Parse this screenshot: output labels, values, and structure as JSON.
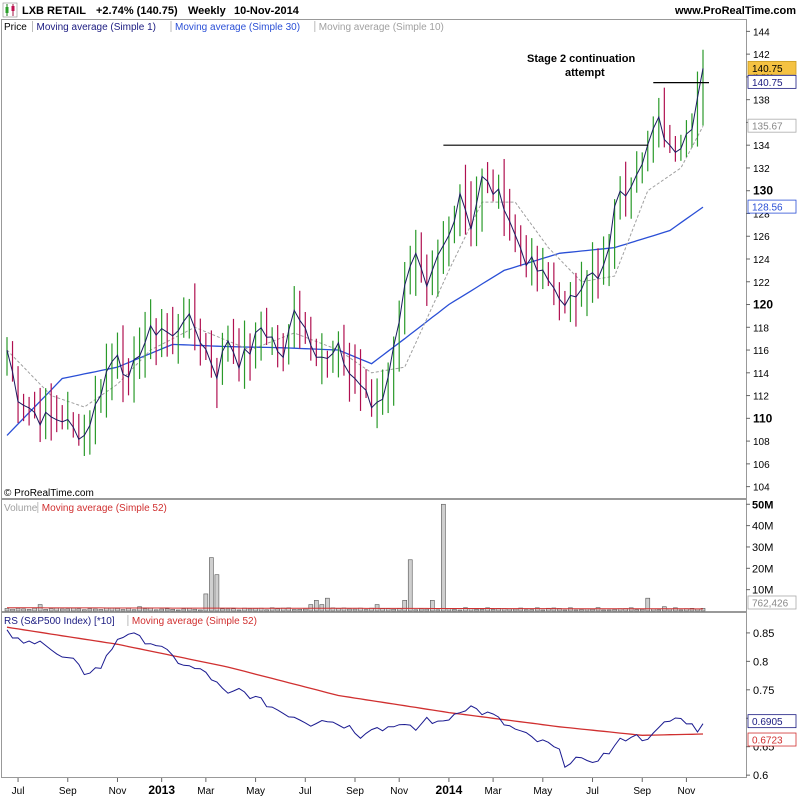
{
  "header": {
    "logo_icon": "candlestick-logo-icon",
    "title": "LXB RETAIL",
    "change": "+2.74% (140.75)",
    "period": "Weekly",
    "date": "10-Nov-2014",
    "website": "www.ProRealTime.com"
  },
  "price_panel": {
    "legend": [
      {
        "text": "Price",
        "color": "#000000"
      },
      {
        "text": "Moving average (Simple 1)",
        "color": "#1a1a80"
      },
      {
        "text": "Moving average (Simple 30)",
        "color": "#2a4fd6"
      },
      {
        "text": "Moving average (Simple 10)",
        "color": "#a0a0a0"
      }
    ],
    "copyright": "© ProRealTime.com",
    "annotation_line1": "Stage 2 continuation",
    "annotation_line2": "attempt",
    "ylim": [
      103,
      145
    ],
    "ticks": [
      "144",
      "142",
      "140",
      "138",
      "136",
      "134",
      "132",
      "130",
      "128",
      "126",
      "124",
      "122",
      "120",
      "118",
      "116",
      "114",
      "112",
      "110",
      "108",
      "106",
      "104"
    ],
    "bold_ticks": [
      "140",
      "130",
      "120",
      "110"
    ],
    "markers": [
      {
        "label": "140.75",
        "value": 140.75,
        "bg": "#f5c242",
        "fg": "#000000",
        "border": "#c89a20"
      },
      {
        "label": "140.75",
        "value": 139.55,
        "bg": "#ffffff",
        "fg": "#1a1a80",
        "border": "#1a1a80"
      },
      {
        "label": "135.67",
        "value": 135.67,
        "bg": "#ffffff",
        "fg": "#888888",
        "border": "#aaaaaa"
      },
      {
        "label": "128.56",
        "value": 128.56,
        "bg": "#ffffff",
        "fg": "#2a4fd6",
        "border": "#2a4fd6"
      }
    ]
  },
  "volume_panel": {
    "legend": [
      {
        "text": "Volume",
        "color": "#a0a0a0"
      },
      {
        "text": "Moving average (Simple 52)",
        "color": "#d03030"
      }
    ],
    "ticks": [
      "50M",
      "40M",
      "30M",
      "20M",
      "10M"
    ],
    "ylim": [
      0,
      52
    ],
    "marker": {
      "label": "762,426",
      "bg": "#ffffff",
      "fg": "#888888",
      "border": "#aaaaaa"
    }
  },
  "rs_panel": {
    "legend": [
      {
        "text": "RS (S&P500 Index) [*10]",
        "color": "#1a1a80"
      },
      {
        "text": "Moving average (Simple 52)",
        "color": "#d03030"
      }
    ],
    "ticks": [
      "0.85",
      "0.8",
      "0.75",
      "0.7",
      "0.65",
      "0.6"
    ],
    "ylim": [
      0.595,
      0.885
    ],
    "markers": [
      {
        "label": "0.6905",
        "value": 0.6905,
        "bg": "#ffffff",
        "fg": "#1a1a80",
        "border": "#1a1a80"
      },
      {
        "label": "0.6723",
        "value": 0.6723,
        "bg": "#ffffff",
        "fg": "#d03030",
        "border": "#d03030"
      }
    ]
  },
  "x_axis": {
    "labels": [
      "Jul",
      "Sep",
      "Nov",
      "2013",
      "Mar",
      "May",
      "Jul",
      "Sep",
      "Nov",
      "2014",
      "Mar",
      "May",
      "Jul",
      "Sep",
      "Nov"
    ],
    "bold_labels": [
      "2013",
      "2014"
    ],
    "week_index": [
      2,
      11,
      20,
      28,
      36,
      45,
      54,
      63,
      71,
      80,
      88,
      97,
      106,
      115,
      123
    ]
  },
  "chart_data": {
    "type": "line",
    "title": "LXB RETAIL",
    "period": "Weekly",
    "x_start": "Jun 2012",
    "x_end": "10-Nov-2014",
    "weeks": 127,
    "price_close_anchors": [
      [
        0,
        116
      ],
      [
        2,
        112
      ],
      [
        6,
        110
      ],
      [
        10,
        110
      ],
      [
        12,
        109
      ],
      [
        14,
        108.5
      ],
      [
        16,
        111
      ],
      [
        18,
        114
      ],
      [
        20,
        116
      ],
      [
        22,
        113
      ],
      [
        24,
        116
      ],
      [
        26,
        117.5
      ],
      [
        28,
        118
      ],
      [
        30,
        117
      ],
      [
        32,
        119
      ],
      [
        34,
        118
      ],
      [
        36,
        116
      ],
      [
        38,
        114
      ],
      [
        40,
        117
      ],
      [
        42,
        115
      ],
      [
        44,
        116
      ],
      [
        46,
        118
      ],
      [
        48,
        117
      ],
      [
        50,
        115
      ],
      [
        52,
        120
      ],
      [
        54,
        118
      ],
      [
        56,
        116
      ],
      [
        58,
        115
      ],
      [
        60,
        116
      ],
      [
        62,
        114
      ],
      [
        64,
        113
      ],
      [
        66,
        111
      ],
      [
        68,
        112
      ],
      [
        70,
        116
      ],
      [
        72,
        122
      ],
      [
        74,
        124
      ],
      [
        76,
        121
      ],
      [
        78,
        124
      ],
      [
        80,
        126
      ],
      [
        82,
        130
      ],
      [
        84,
        127
      ],
      [
        86,
        131
      ],
      [
        88,
        130
      ],
      [
        90,
        129
      ],
      [
        92,
        126
      ],
      [
        94,
        124
      ],
      [
        96,
        123
      ],
      [
        98,
        122
      ],
      [
        100,
        121
      ],
      [
        101,
        119.5
      ],
      [
        103,
        121
      ],
      [
        105,
        123
      ],
      [
        107,
        122
      ],
      [
        109,
        124.5
      ],
      [
        110,
        129
      ],
      [
        112,
        130
      ],
      [
        114,
        132
      ],
      [
        116,
        134
      ],
      [
        118,
        136
      ],
      [
        120,
        134
      ],
      [
        122,
        134
      ],
      [
        124,
        136
      ],
      [
        126,
        140.75
      ]
    ],
    "sma30_anchors": [
      [
        0,
        108.5
      ],
      [
        10,
        113.5
      ],
      [
        20,
        114.5
      ],
      [
        30,
        116.5
      ],
      [
        40,
        116.3
      ],
      [
        50,
        116.2
      ],
      [
        60,
        116
      ],
      [
        66,
        114.8
      ],
      [
        72,
        117
      ],
      [
        80,
        120
      ],
      [
        90,
        123
      ],
      [
        100,
        124.5
      ],
      [
        110,
        125
      ],
      [
        120,
        126.5
      ],
      [
        126,
        128.56
      ]
    ],
    "sma10_anchors": [
      [
        0,
        116
      ],
      [
        8,
        112
      ],
      [
        14,
        111
      ],
      [
        20,
        113
      ],
      [
        26,
        116
      ],
      [
        34,
        118
      ],
      [
        44,
        116
      ],
      [
        52,
        117.5
      ],
      [
        60,
        116
      ],
      [
        66,
        114
      ],
      [
        72,
        114.5
      ],
      [
        80,
        123
      ],
      [
        86,
        129
      ],
      [
        92,
        129
      ],
      [
        98,
        125
      ],
      [
        104,
        122
      ],
      [
        110,
        122.5
      ],
      [
        116,
        130
      ],
      [
        122,
        132
      ],
      [
        126,
        135.67
      ]
    ],
    "breakout_line_1": {
      "x": [
        79,
        115
      ],
      "y": [
        134,
        134
      ]
    },
    "breakout_line_2": {
      "x": [
        117,
        126
      ],
      "y": [
        139.5,
        139.5
      ]
    },
    "volume_spikes_millions": [
      [
        6,
        3
      ],
      [
        9,
        1.5
      ],
      [
        13,
        1
      ],
      [
        19,
        1.5
      ],
      [
        24,
        2
      ],
      [
        29,
        1
      ],
      [
        36,
        8
      ],
      [
        37,
        25
      ],
      [
        38,
        17
      ],
      [
        49,
        1
      ],
      [
        55,
        3
      ],
      [
        56,
        5
      ],
      [
        57,
        3
      ],
      [
        58,
        6
      ],
      [
        67,
        3
      ],
      [
        72,
        5
      ],
      [
        73,
        24
      ],
      [
        77,
        5
      ],
      [
        79,
        50
      ],
      [
        91,
        1
      ],
      [
        96,
        1.5
      ],
      [
        102,
        1.5
      ],
      [
        105,
        1
      ],
      [
        113,
        1.5
      ],
      [
        116,
        6
      ],
      [
        119,
        2
      ],
      [
        121,
        1.5
      ],
      [
        125,
        1
      ]
    ],
    "volume_baseline_millions": 1.2,
    "volume_sma52_millions": 0.76,
    "rs_anchors": [
      [
        0,
        0.85
      ],
      [
        3,
        0.83
      ],
      [
        6,
        0.84
      ],
      [
        9,
        0.81
      ],
      [
        12,
        0.8
      ],
      [
        14,
        0.78
      ],
      [
        17,
        0.79
      ],
      [
        20,
        0.84
      ],
      [
        22,
        0.85
      ],
      [
        24,
        0.84
      ],
      [
        27,
        0.83
      ],
      [
        29,
        0.815
      ],
      [
        31,
        0.8
      ],
      [
        33,
        0.79
      ],
      [
        36,
        0.78
      ],
      [
        38,
        0.76
      ],
      [
        40,
        0.74
      ],
      [
        42,
        0.75
      ],
      [
        44,
        0.74
      ],
      [
        46,
        0.73
      ],
      [
        48,
        0.72
      ],
      [
        50,
        0.71
      ],
      [
        53,
        0.7
      ],
      [
        55,
        0.69
      ],
      [
        57,
        0.7
      ],
      [
        60,
        0.69
      ],
      [
        62,
        0.685
      ],
      [
        64,
        0.67
      ],
      [
        66,
        0.685
      ],
      [
        68,
        0.68
      ],
      [
        70,
        0.69
      ],
      [
        72,
        0.685
      ],
      [
        74,
        0.68
      ],
      [
        76,
        0.7
      ],
      [
        78,
        0.69
      ],
      [
        80,
        0.7
      ],
      [
        82,
        0.715
      ],
      [
        84,
        0.72
      ],
      [
        86,
        0.71
      ],
      [
        88,
        0.705
      ],
      [
        90,
        0.69
      ],
      [
        92,
        0.68
      ],
      [
        94,
        0.67
      ],
      [
        96,
        0.66
      ],
      [
        98,
        0.655
      ],
      [
        100,
        0.64
      ],
      [
        101,
        0.62
      ],
      [
        103,
        0.63
      ],
      [
        105,
        0.62
      ],
      [
        107,
        0.63
      ],
      [
        109,
        0.64
      ],
      [
        111,
        0.66
      ],
      [
        113,
        0.67
      ],
      [
        115,
        0.665
      ],
      [
        117,
        0.67
      ],
      [
        119,
        0.69
      ],
      [
        121,
        0.7
      ],
      [
        123,
        0.695
      ],
      [
        125,
        0.68
      ],
      [
        126,
        0.6905
      ]
    ],
    "rs_sma52_anchors": [
      [
        0,
        0.86
      ],
      [
        20,
        0.83
      ],
      [
        40,
        0.79
      ],
      [
        60,
        0.74
      ],
      [
        80,
        0.71
      ],
      [
        100,
        0.685
      ],
      [
        115,
        0.67
      ],
      [
        126,
        0.6723
      ]
    ]
  }
}
